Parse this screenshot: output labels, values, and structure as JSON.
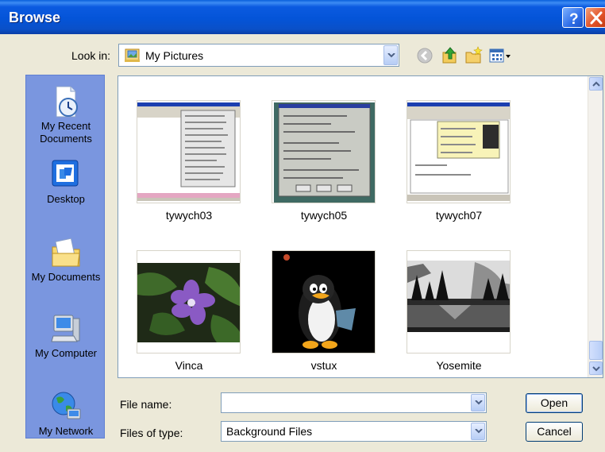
{
  "window": {
    "title": "Browse"
  },
  "look_in": {
    "label": "Look in:",
    "value": "My Pictures"
  },
  "places": [
    {
      "label": "My Recent Documents",
      "icon": "recent-documents-icon"
    },
    {
      "label": "Desktop",
      "icon": "desktop-icon"
    },
    {
      "label": "My Documents",
      "icon": "my-documents-icon"
    },
    {
      "label": "My Computer",
      "icon": "my-computer-icon"
    },
    {
      "label": "My Network",
      "icon": "my-network-icon"
    }
  ],
  "files": [
    {
      "name": "tywych03"
    },
    {
      "name": "tywych05"
    },
    {
      "name": "tywych07"
    },
    {
      "name": "Vinca"
    },
    {
      "name": "vstux"
    },
    {
      "name": "Yosemite"
    }
  ],
  "file_name": {
    "label": "File name:",
    "value": ""
  },
  "file_type": {
    "label": "Files of type:",
    "value": "Background Files"
  },
  "buttons": {
    "open": "Open",
    "cancel": "Cancel"
  },
  "colors": {
    "title_bar": "#0454d8",
    "places_bar": "#7a96df",
    "dialog_bg": "#ece9d8"
  }
}
